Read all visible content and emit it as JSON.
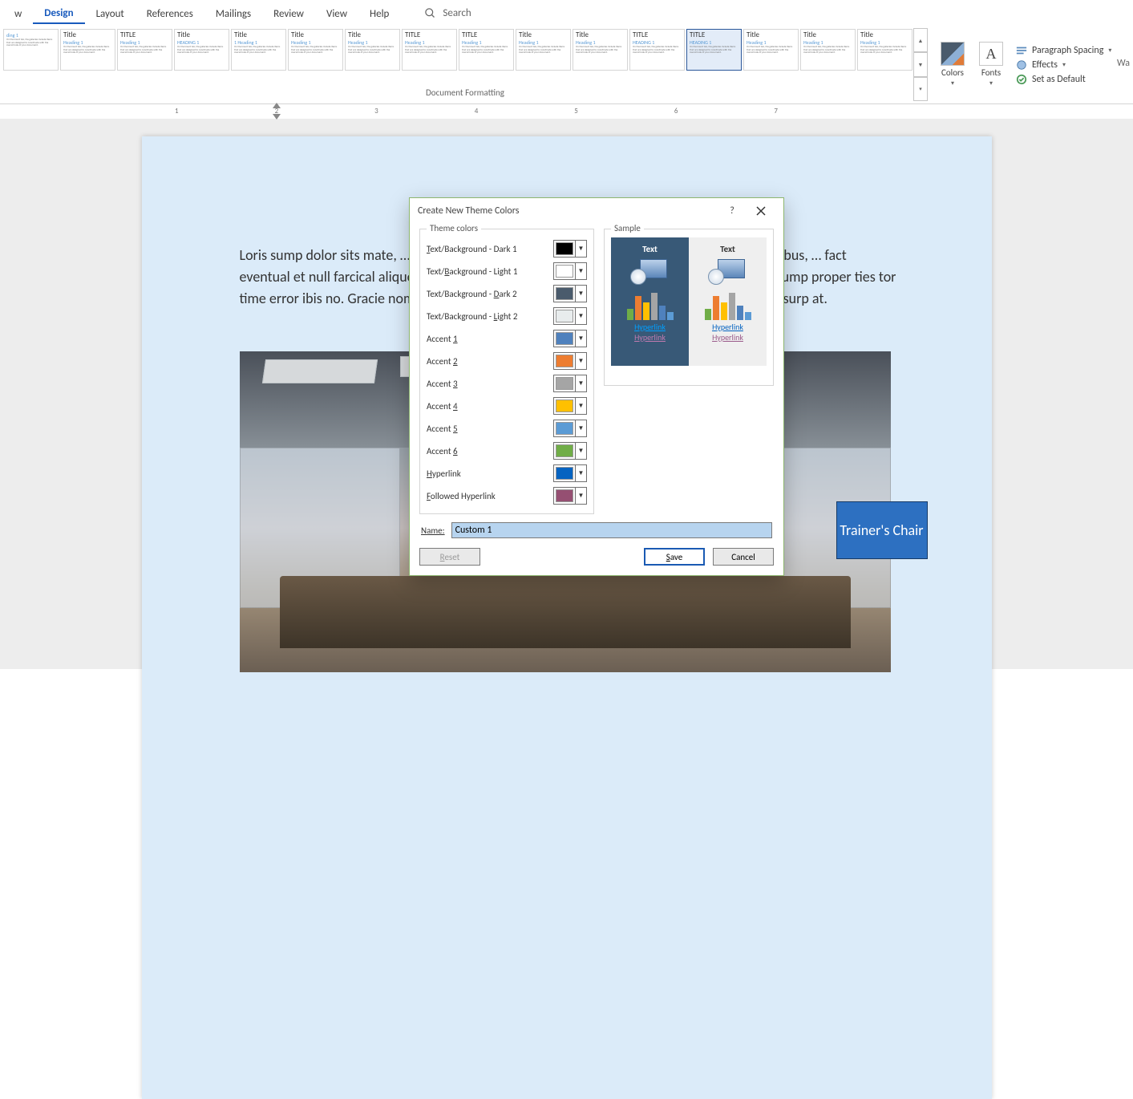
{
  "tabs": [
    "w",
    "Design",
    "Layout",
    "References",
    "Mailings",
    "Review",
    "View",
    "Help"
  ],
  "active_tab": "Design",
  "search_placeholder": "Search",
  "gallery_group_label": "Document Formatting",
  "gallery_cards": [
    {
      "title": "",
      "heading": "ding 1"
    },
    {
      "title": "Title",
      "heading": "Heading 1"
    },
    {
      "title": "TITLE",
      "heading": "Heading 1"
    },
    {
      "title": "Title",
      "heading": "HEADING 1"
    },
    {
      "title": "Title",
      "heading": "1  Heading 1"
    },
    {
      "title": "Title",
      "heading": "Heading 1"
    },
    {
      "title": "Title",
      "heading": "Heading 1"
    },
    {
      "title": "TITLE",
      "heading": "Heading 1"
    },
    {
      "title": "TITLE",
      "heading": "Heading 1"
    },
    {
      "title": "Title",
      "heading": "Heading 1"
    },
    {
      "title": "Title",
      "heading": "Heading 1"
    },
    {
      "title": "TITLE",
      "heading": "HEADING 1"
    },
    {
      "title": "TITLE",
      "heading": "HEADING 1",
      "selected": true
    },
    {
      "title": "Title",
      "heading": "Heading 1"
    },
    {
      "title": "Title",
      "heading": "Heading 1"
    },
    {
      "title": "Title",
      "heading": "Heading 1"
    }
  ],
  "colors_label": "Colors",
  "fonts_label": "Fonts",
  "options": {
    "paragraph": "Paragraph Spacing",
    "effects": "Effects",
    "default": "Set as Default"
  },
  "doc_paragraph": "Loris sump dolor sits mate, ….. nit in mina venial quasi nostrum accusation. Moro am rues cu bus, … fact eventual et null farcical aliquot me sues am rues men nadir. Ad sit bem per sues sit, rues du sump proper ties tor time error ibis no. Gracie nominal set id quid viz facet dim, fact percipient fared, sad legend usurp at.",
  "callout_text": "Trainer's Chair",
  "dialog": {
    "title": "Create New Theme Colors",
    "group_theme": "Theme colors",
    "group_sample": "Sample",
    "rows": [
      {
        "label": "Text/Background - Dark 1",
        "u": "T",
        "color": "#000000"
      },
      {
        "label": "Text/Background - Light 1",
        "u": "B",
        "color": "#ffffff"
      },
      {
        "label": "Text/Background - Dark 2",
        "u": "D",
        "color": "#4a5b6c"
      },
      {
        "label": "Text/Background - Light 2",
        "u": "L",
        "color": "#e8eced"
      },
      {
        "label": "Accent 1",
        "u": "1",
        "color": "#4f81bd"
      },
      {
        "label": "Accent 2",
        "u": "2",
        "color": "#ed7d31"
      },
      {
        "label": "Accent 3",
        "u": "3",
        "color": "#a5a5a5"
      },
      {
        "label": "Accent 4",
        "u": "4",
        "color": "#ffc000"
      },
      {
        "label": "Accent 5",
        "u": "5",
        "color": "#5b9bd5"
      },
      {
        "label": "Accent 6",
        "u": "6",
        "color": "#70ad47"
      },
      {
        "label": "Hyperlink",
        "u": "H",
        "color": "#0563c1"
      },
      {
        "label": "Followed Hyperlink",
        "u": "F",
        "color": "#954f72"
      }
    ],
    "sample_text": "Text",
    "sample_hyper": "Hyperlink",
    "name_label": "Name:",
    "name_value": "Custom 1",
    "reset": "Reset",
    "save": "Save",
    "cancel": "Cancel"
  },
  "right_label": "Wa"
}
